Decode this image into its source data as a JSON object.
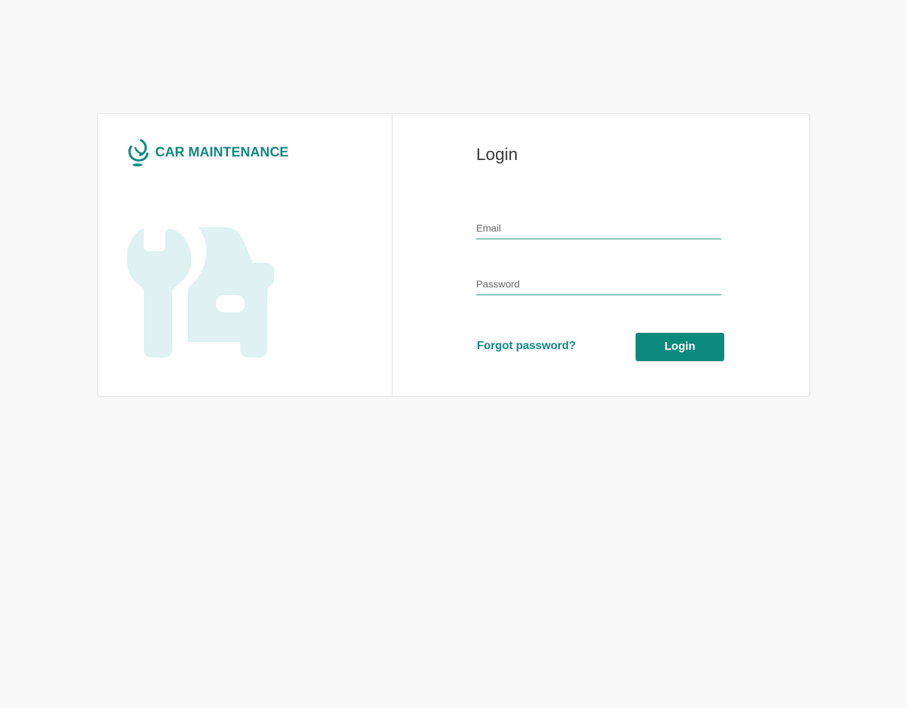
{
  "brand": {
    "name": "CAR MAINTENANCE",
    "logo_icon": "brand-logo-icon",
    "color": "#0d8a7e"
  },
  "illustration": {
    "icon": "car-repair-icon",
    "color": "#dff1f1"
  },
  "login": {
    "title": "Login",
    "email_placeholder": "Email",
    "password_placeholder": "Password",
    "forgot_label": "Forgot password?",
    "button_label": "Login"
  },
  "colors": {
    "accent": "#0d8a7e",
    "page_background": "#f9f9f9",
    "card_background": "#ffffff"
  }
}
